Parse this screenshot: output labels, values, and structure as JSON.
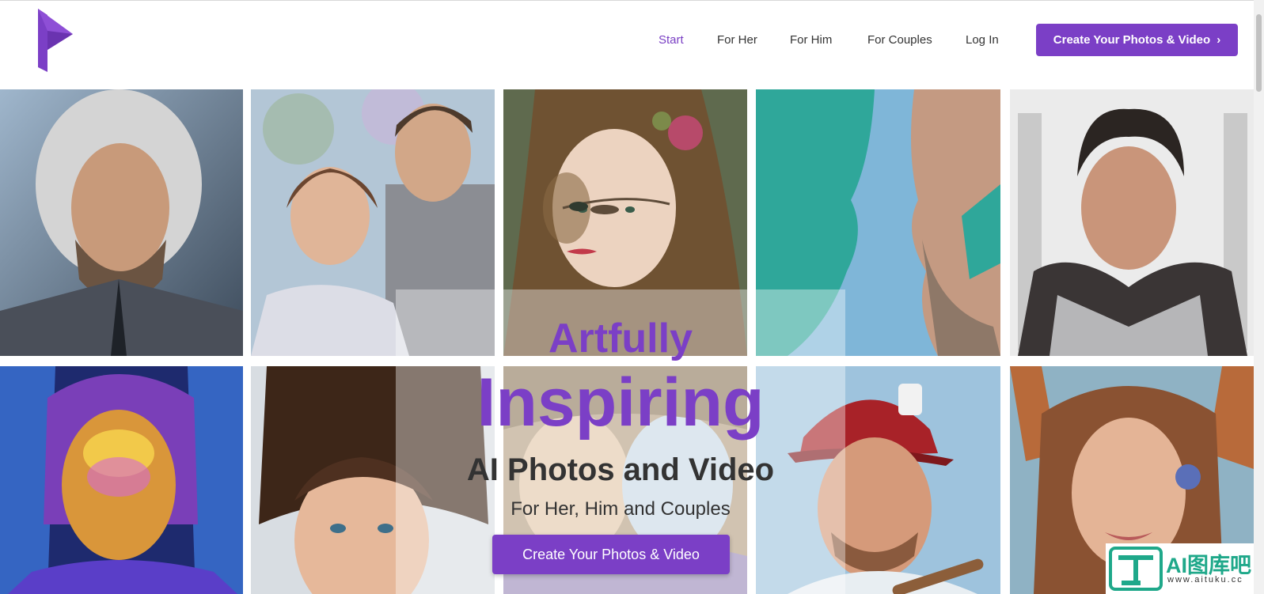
{
  "header": {
    "nav": [
      {
        "label": "Start",
        "active": true
      },
      {
        "label": "For Her",
        "active": false
      },
      {
        "label": "For Him",
        "active": false
      },
      {
        "label": "For Couples",
        "active": false
      },
      {
        "label": "Log In",
        "active": false
      }
    ],
    "cta_label": "Create Your Photos & Video"
  },
  "hero": {
    "line1": "Artfully",
    "line2": "Inspiring",
    "line3": "AI Photos and Video",
    "line4": "For Her, Him and Couples",
    "cta_label": "Create Your Photos & Video"
  },
  "gallery": [
    "portrait-man-silver-hair",
    "portrait-couple-formal",
    "portrait-woman-flowers",
    "portrait-couple-teal",
    "portrait-man-armor",
    "portrait-woman-neon",
    "portrait-young-man-curly",
    "portrait-couple-fantasy",
    "portrait-man-baseball-cap",
    "portrait-woman-fairy"
  ],
  "watermark": {
    "brand": "AI图库吧",
    "url": "www.aituku.cc"
  },
  "colors": {
    "accent": "#7b3fc6",
    "text": "#333333"
  }
}
